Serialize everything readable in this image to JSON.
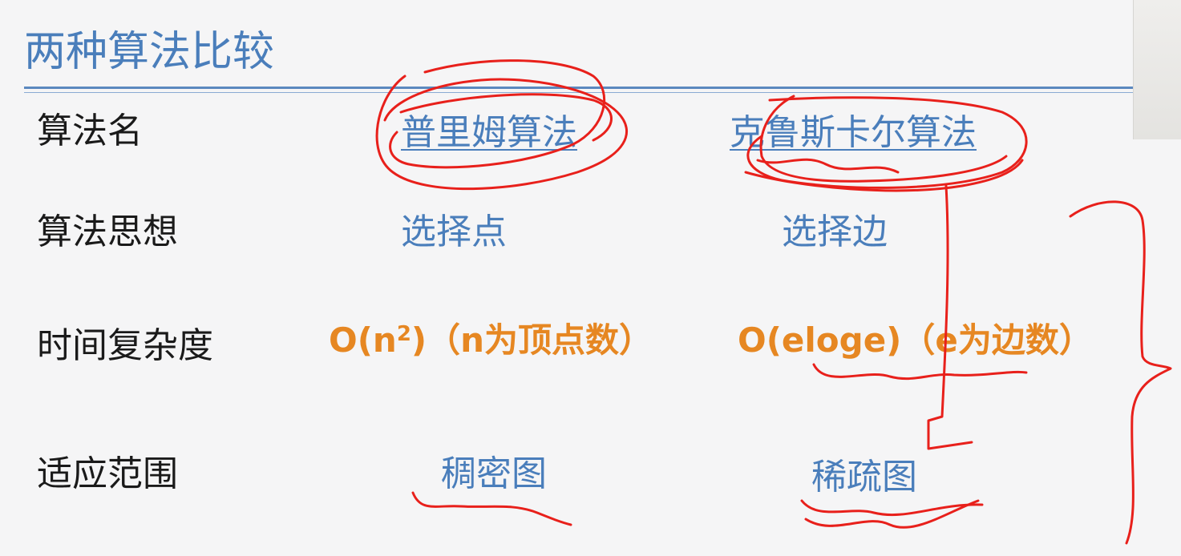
{
  "slide": {
    "title": "两种算法比较"
  },
  "rows": {
    "name": {
      "label": "算法名",
      "prim": "普里姆算法",
      "kruskal": "克鲁斯卡尔算法"
    },
    "idea": {
      "label": "算法思想",
      "prim": "选择点",
      "kruskal": "选择边"
    },
    "complexity": {
      "label": "时间复杂度",
      "prim_pre": "O(n",
      "prim_sup": "2",
      "prim_post": ")（n为顶点数）",
      "kruskal": "O(eloge)（e为边数）"
    },
    "scope": {
      "label": "适应范围",
      "prim": "稠密图",
      "kruskal": "稀疏图"
    }
  },
  "colors": {
    "title_blue": "#4a7ebb",
    "orange": "#e68722",
    "ink_red": "#e8201b"
  }
}
